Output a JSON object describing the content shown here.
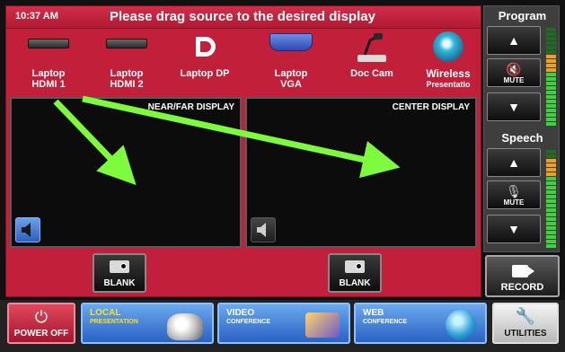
{
  "header": {
    "time": "10:37 AM",
    "instruction": "Please drag source to the desired display"
  },
  "sources": [
    {
      "line1": "Laptop",
      "line2": "HDMI 1",
      "icon": "hdmi-port-icon"
    },
    {
      "line1": "Laptop",
      "line2": "HDMI 2",
      "icon": "hdmi-port-icon"
    },
    {
      "line1": "",
      "line2": "Laptop DP",
      "icon": "displayport-icon"
    },
    {
      "line1": "Laptop",
      "line2": "VGA",
      "icon": "vga-port-icon"
    },
    {
      "line1": "",
      "line2": "Doc Cam",
      "icon": "document-camera-icon"
    },
    {
      "line1": "Wireless",
      "line2": "Presentatio",
      "icon": "wireless-presentation-icon"
    }
  ],
  "displays": [
    {
      "title": "NEAR/FAR DISPLAY",
      "blank_label": "BLANK",
      "audio_active": true
    },
    {
      "title": "CENTER DISPLAY",
      "blank_label": "BLANK",
      "audio_active": false
    }
  ],
  "volume": {
    "program": {
      "title": "Program",
      "mute_label": "MUTE"
    },
    "speech": {
      "title": "Speech",
      "mute_label": "MUTE"
    }
  },
  "record": {
    "label": "RECORD"
  },
  "bottom": {
    "power_label": "POWER OFF",
    "local": {
      "line1": "LOCAL",
      "line2": "PRESENTATION"
    },
    "video": {
      "line1": "VIDEO",
      "line2": "CONFERENCE"
    },
    "web": {
      "line1": "WEB",
      "line2": "CONFERENCE"
    },
    "utilities_label": "UTILITIES"
  },
  "colors": {
    "panel_red": "#c2203a",
    "mode_blue": "#4a86da",
    "drag_arrow": "#7cfc3c",
    "meter_green": "#3cd23c",
    "meter_orange": "#f0a020"
  }
}
